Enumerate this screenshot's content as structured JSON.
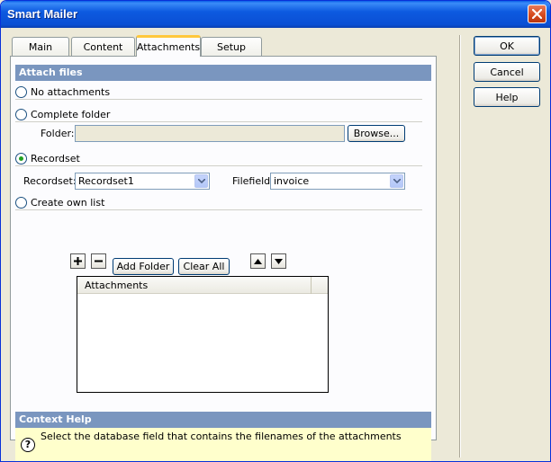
{
  "window": {
    "title": "Smart Mailer"
  },
  "tabs": [
    {
      "label": "Main"
    },
    {
      "label": "Content"
    },
    {
      "label": "Attachments",
      "active": true
    },
    {
      "label": "Setup"
    }
  ],
  "buttons": {
    "ok": "OK",
    "cancel": "Cancel",
    "help": "Help"
  },
  "attach": {
    "header": "Attach files",
    "options": {
      "none": "No attachments",
      "folder": "Complete folder",
      "recordset": "Recordset",
      "own": "Create own list"
    },
    "selected": "recordset",
    "folder_label": "Folder:",
    "folder_value": "",
    "browse": "Browse...",
    "recordset_label": "Recordset:",
    "recordset_value": "Recordset1",
    "filefield_label": "Filefield:",
    "filefield_value": "invoice",
    "add_folder": "Add Folder",
    "clear_all": "Clear All",
    "list_header": "Attachments",
    "list_items": []
  },
  "context_help": {
    "header": "Context Help",
    "text": "Select the database field that contains the filenames of the attachments",
    "icon_glyph": "?"
  },
  "colors": {
    "title_bar": "#0a4fd4",
    "section_header": "#7a96bf",
    "help_bg": "#ffffcc",
    "radio_selected": "#21a121",
    "active_tab_accent": "#ffc83c"
  },
  "icons": {
    "close": "close-icon",
    "plus": "plus-icon",
    "minus": "minus-icon",
    "up": "arrow-up-icon",
    "down": "arrow-down-icon",
    "dropdown": "chevron-down-icon",
    "help": "help-icon"
  }
}
